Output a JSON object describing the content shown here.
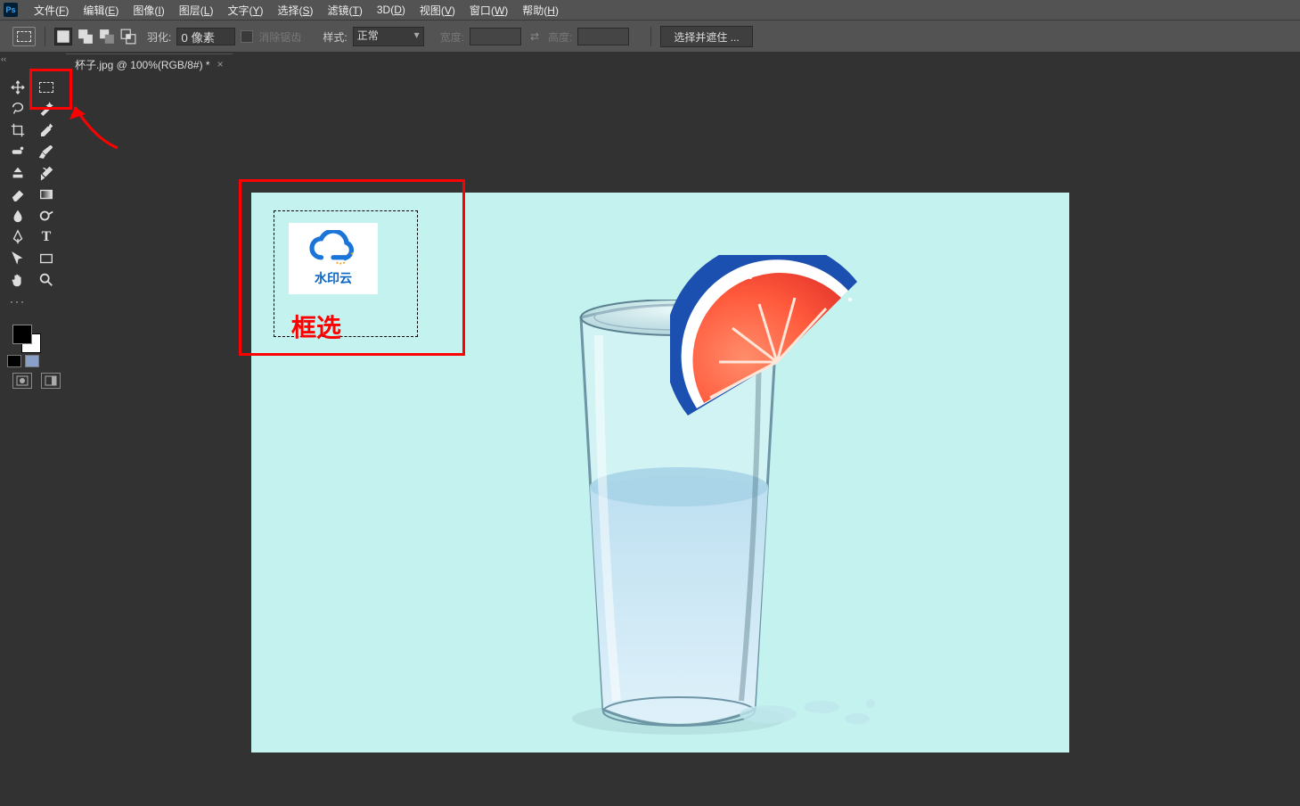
{
  "menu": {
    "items": [
      {
        "label": "文件",
        "accel": "F"
      },
      {
        "label": "编辑",
        "accel": "E"
      },
      {
        "label": "图像",
        "accel": "I"
      },
      {
        "label": "图层",
        "accel": "L"
      },
      {
        "label": "文字",
        "accel": "Y"
      },
      {
        "label": "选择",
        "accel": "S"
      },
      {
        "label": "滤镜",
        "accel": "T"
      },
      {
        "label": "3D",
        "accel": "D"
      },
      {
        "label": "视图",
        "accel": "V"
      },
      {
        "label": "窗口",
        "accel": "W"
      },
      {
        "label": "帮助",
        "accel": "H"
      }
    ]
  },
  "options": {
    "feather_label": "羽化:",
    "feather_value": "0 像素",
    "antialias_label": "消除锯齿",
    "style_label": "样式:",
    "style_value": "正常",
    "width_label": "宽度:",
    "height_label": "高度:",
    "select_mask_btn": "选择并遮住 ..."
  },
  "document": {
    "tab_title": "杯子.jpg @ 100%(RGB/8#) *"
  },
  "watermark": {
    "text": "水印云"
  },
  "annotation": {
    "label": "框选"
  },
  "tools_left": [
    "move",
    "lasso",
    "crop",
    "healing",
    "clone",
    "eraser",
    "blur",
    "pen",
    "path-select",
    "hand",
    "more"
  ],
  "tools_right": [
    "marquee",
    "magic-wand",
    "eyedropper",
    "brush",
    "history-brush",
    "gradient",
    "dodge",
    "type",
    "rectangle",
    "zoom"
  ]
}
